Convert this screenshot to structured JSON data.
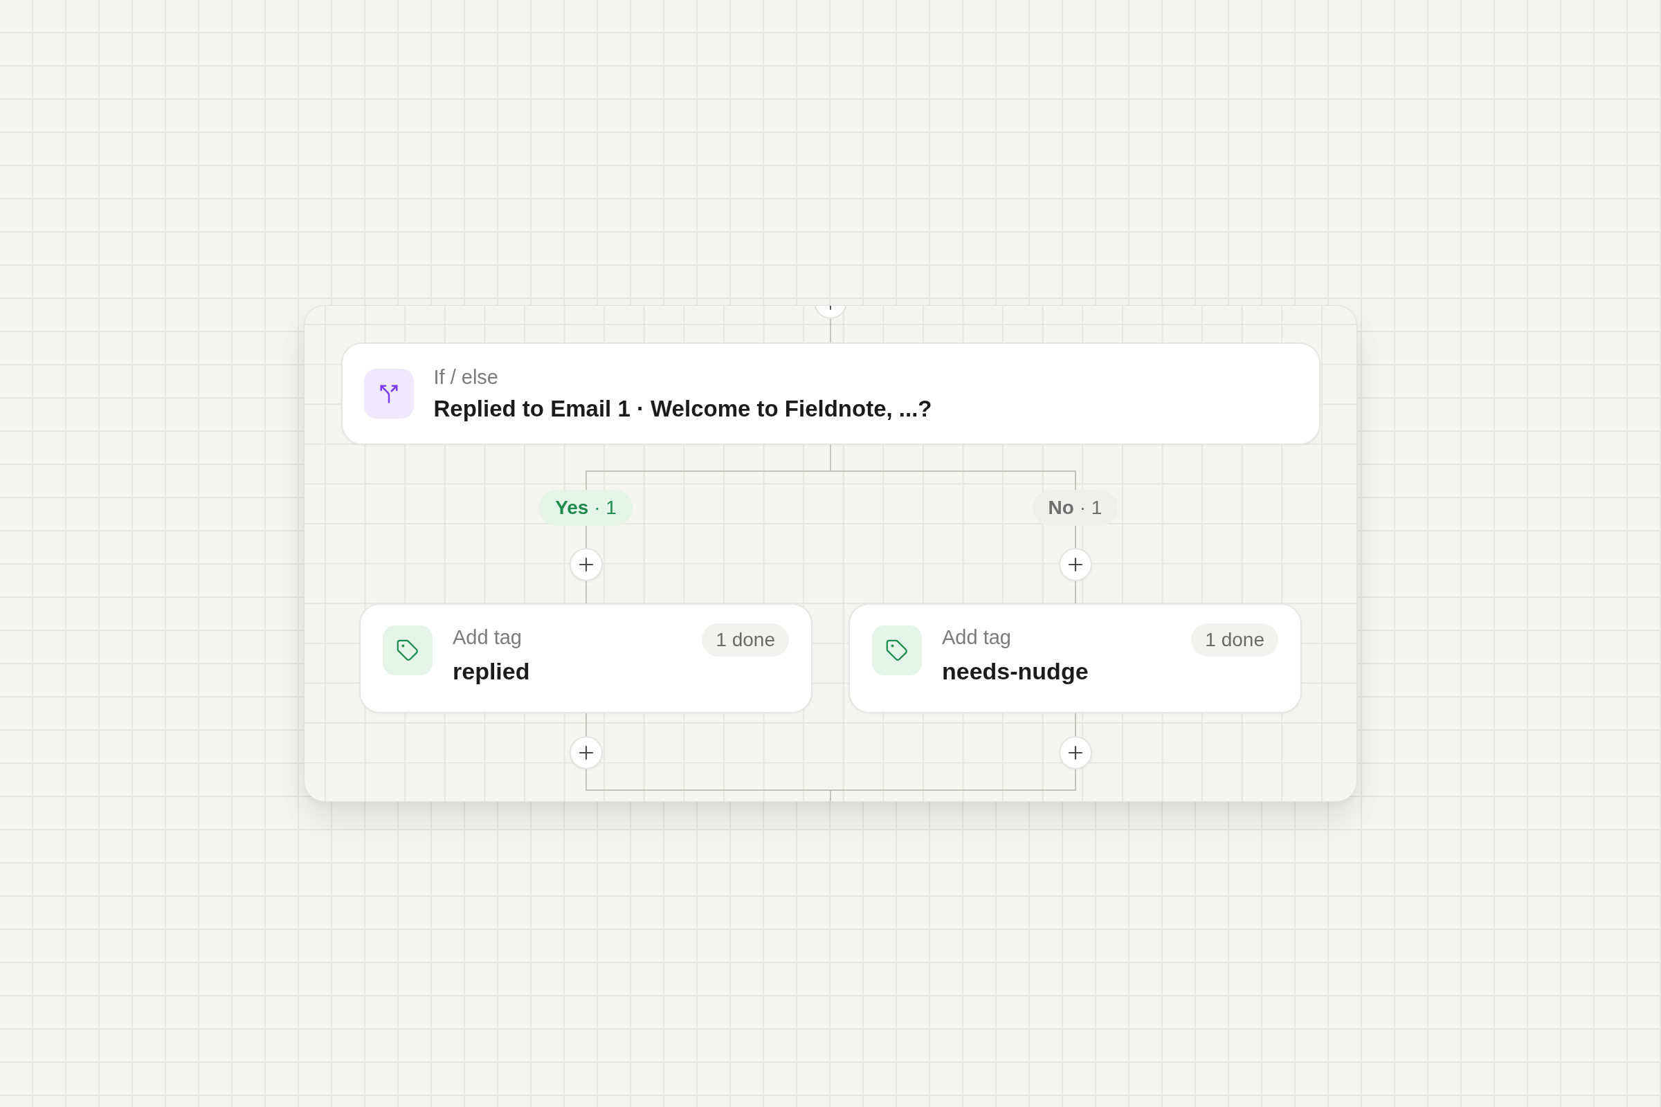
{
  "canvas": {
    "condition": {
      "kind": "if_else",
      "label": "If / else",
      "title": "Replied to Email 1 · Welcome to Fieldnote, ...?"
    },
    "branches": [
      {
        "kind": "yes",
        "label": "**Yes** · 1",
        "steps": [
          {
            "kind": "add_tag",
            "label": "Add tag",
            "value": "replied",
            "status": "1 done"
          }
        ]
      },
      {
        "kind": "no",
        "label": "**No** · 1",
        "steps": [
          {
            "kind": "add_tag",
            "label": "Add tag",
            "value": "needs-nudge",
            "status": "1 done"
          }
        ]
      }
    ]
  }
}
